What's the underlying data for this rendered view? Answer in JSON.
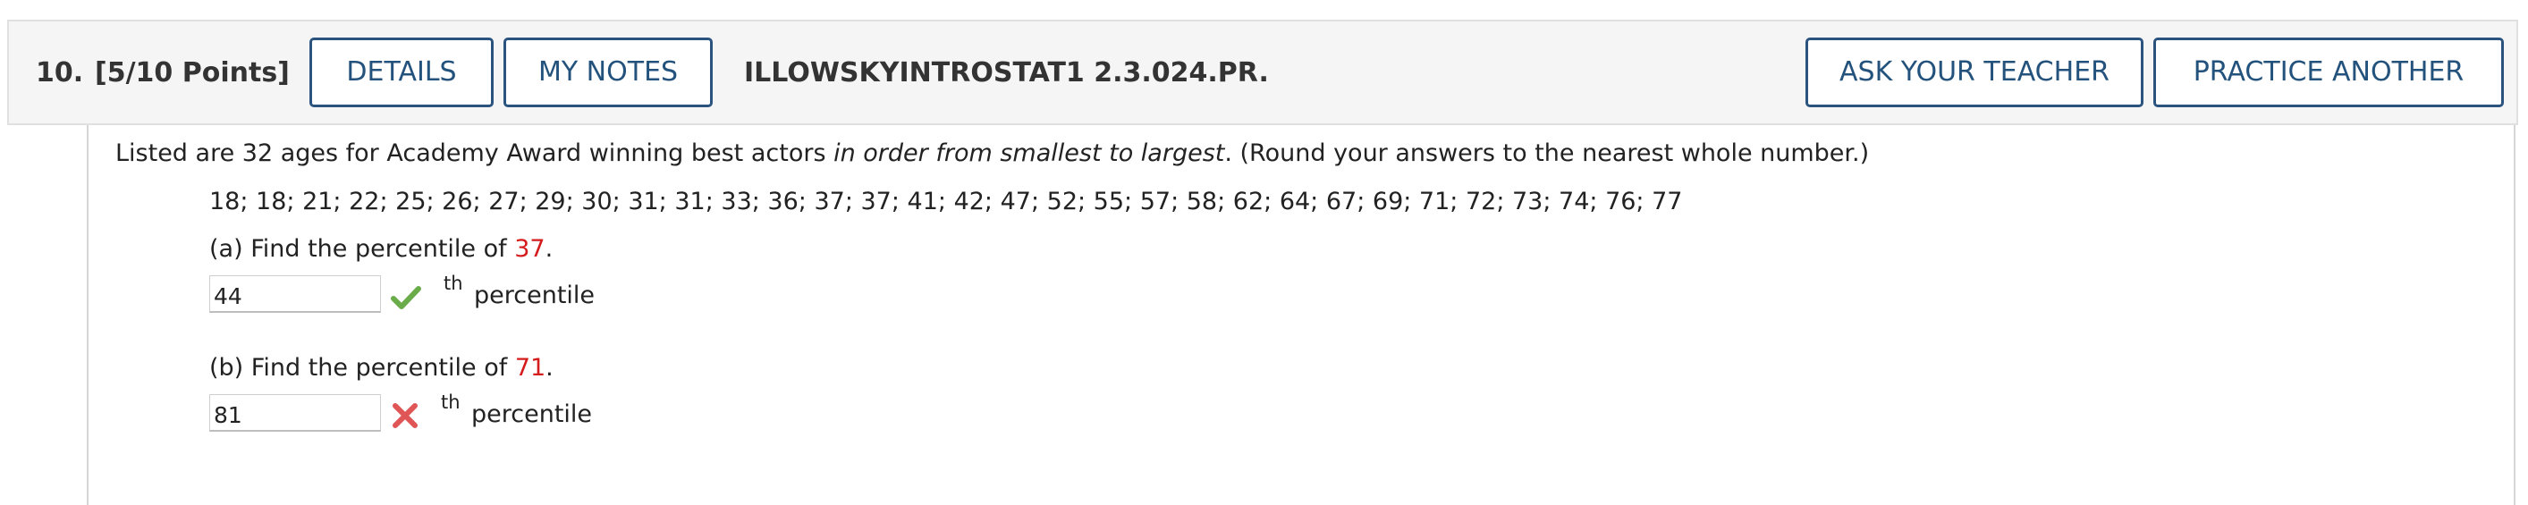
{
  "header": {
    "question_number": "10.",
    "points": "[5/10 Points]",
    "details_label": "DETAILS",
    "my_notes_label": "MY NOTES",
    "assignment_code": "ILLOWSKYINTROSTAT1 2.3.024.PR.",
    "ask_teacher_label": "ASK YOUR TEACHER",
    "practice_another_label": "PRACTICE ANOTHER"
  },
  "question": {
    "intro_prefix": "Listed are 32 ages for Academy Award winning best actors ",
    "intro_emphasis": "in order from smallest to largest",
    "intro_suffix": ". (Round your answers to the nearest whole number.)",
    "data_list": "18; 18; 21; 22; 25; 26; 27; 29; 30; 31; 31; 33; 36; 37; 37; 41; 42; 47; 52; 55; 57; 58; 62; 64; 67; 69; 71; 72; 73; 74; 76; 77",
    "part_a": {
      "prefix": "(a) Find the percentile of ",
      "value": "37",
      "suffix": ".",
      "answer": "44",
      "superscript": "th",
      "unit": "percentile",
      "status": "correct",
      "status_icon": "checkmark-icon"
    },
    "part_b": {
      "prefix": "(b) Find the percentile of ",
      "value": "71",
      "suffix": ".",
      "answer": "81",
      "superscript": "th",
      "unit": "percentile",
      "status": "incorrect",
      "status_icon": "x-mark-icon"
    }
  },
  "colors": {
    "button_border": "#2a5380",
    "button_text": "#23527c",
    "highlight_value": "#d41c1c",
    "correct": "#6aac4a",
    "incorrect": "#e05555"
  }
}
